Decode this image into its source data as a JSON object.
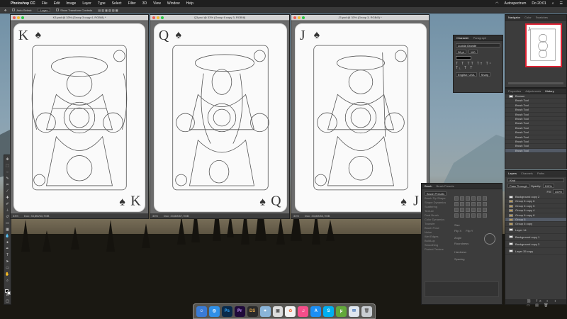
{
  "menubar": {
    "app_name": "Photoshop CC",
    "items": [
      "File",
      "Edit",
      "Image",
      "Layer",
      "Type",
      "Select",
      "Filter",
      "3D",
      "View",
      "Window",
      "Help"
    ],
    "right_name": "Autospectrum",
    "clock": "Do 20:01"
  },
  "options_bar": {
    "auto_select_label": "Auto-Select:",
    "layer_value": "Layer",
    "show_transform_label": "Show Transform Controls"
  },
  "documents": [
    {
      "title": "K3.psd @ 33% (Group 3 copy 4, RGB/8) *",
      "zoom": "33%",
      "doc_info": "Doc: 33,8M/63,7MB"
    },
    {
      "title": "Q3.psd @ 33% (Group 6 copy 3, RGB/8)",
      "zoom": "33%",
      "doc_info": "Doc: 33,8M/67,7MB"
    },
    {
      "title": "J3.psd @ 33% (Group 3, RGB/8) *",
      "zoom": "33%",
      "doc_info": "Doc: 33,8M/63,7MB"
    }
  ],
  "cards": [
    {
      "rank": "K",
      "suit": "♠"
    },
    {
      "rank": "Q",
      "suit": "♠"
    },
    {
      "rank": "J",
      "suit": "♠"
    }
  ],
  "navigator": {
    "tabs": [
      "Navigator",
      "Color",
      "Swatches"
    ]
  },
  "character": {
    "tabs": [
      "Character",
      "Paragraph"
    ],
    "font": "Lucida Grande",
    "size": "36 pt",
    "tracking": "100",
    "language": "English: USA",
    "aa": "Sharp"
  },
  "history": {
    "tabs": [
      "Properties",
      "Adjustments",
      "History"
    ],
    "source": "Browse",
    "steps": [
      "Brush Tool",
      "Brush Tool",
      "Brush Tool",
      "Brush Tool",
      "Brush Tool",
      "Brush Tool",
      "Brush Tool",
      "Brush Tool",
      "Brush Tool",
      "Brush Tool",
      "Brush Tool",
      "Brush Tool"
    ]
  },
  "layers": {
    "tabs": [
      "Layers",
      "Channels",
      "Paths"
    ],
    "kind": "Kind",
    "blend": "Pass Through",
    "opacity_label": "Opacity:",
    "opacity": "100%",
    "fill_label": "Fill:",
    "fill": "100%",
    "items": [
      "Background copy 2",
      "Group 6 copy 6",
      "Group 6 copy 5",
      "Group 6 copy 4",
      "Group 6 copy 8",
      "Group 5",
      "Group 6 copy",
      "Layer 14",
      "Background copy 1",
      "Background copy 3",
      "Layer 35 copy"
    ],
    "selected_index": 5
  },
  "brush": {
    "tabs": [
      "Brush",
      "Brush Presets"
    ],
    "presets_button": "Brush Presets",
    "options": [
      "Brush Tip Shape",
      "Shape Dynamics",
      "Scattering",
      "Texture",
      "Dual Brush",
      "Color Dynamics",
      "Transfer",
      "Brush Pose",
      "Noise",
      "Wet Edges",
      "Build-up",
      "Smoothing",
      "Protect Texture"
    ],
    "size_label": "Size",
    "flip_x": "Flip X",
    "flip_y": "Flip Y",
    "angle_label": "Angle",
    "roundness_label": "Roundness",
    "hardness_label": "Hardness",
    "spacing_label": "Spacing"
  },
  "colors": {
    "accent_red": "#d02233",
    "panel_bg": "#3c3c3c",
    "selected_row": "#535a66"
  },
  "dock_icons": [
    "finder-icon",
    "safari-icon",
    "photoshop-icon",
    "premiere-icon",
    "daz-studio-icon",
    "maps-icon",
    "preview-icon",
    "photos-icon",
    "itunes-icon",
    "appstore-icon",
    "skype-icon",
    "utorrent-icon",
    "mail-icon",
    "trash-icon"
  ]
}
